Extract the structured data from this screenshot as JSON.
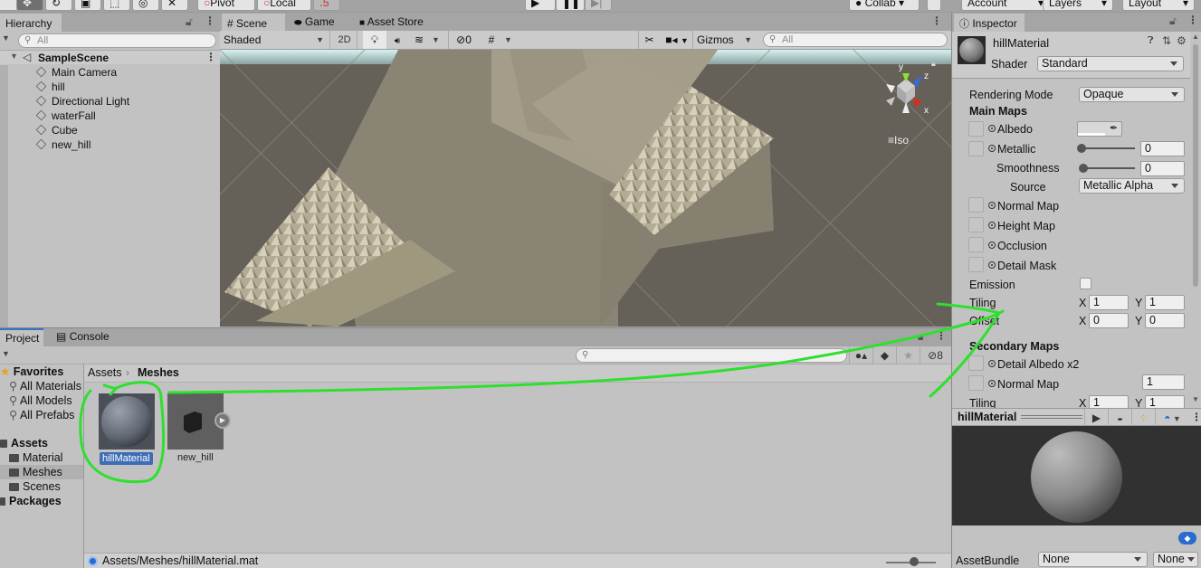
{
  "toolbar": {
    "pivot_label": "Pivot",
    "local_label": "Local",
    "collab_label": "Collab",
    "account_label": "Account",
    "layers_label": "Layers",
    "layout_label": "Layout"
  },
  "hierarchy": {
    "tab_label": "Hierarchy",
    "search_placeholder": "All",
    "scene_name": "SampleScene",
    "items": [
      {
        "label": "Main Camera"
      },
      {
        "label": "hill"
      },
      {
        "label": "Directional Light"
      },
      {
        "label": "waterFall"
      },
      {
        "label": "Cube"
      },
      {
        "label": "new_hill"
      }
    ]
  },
  "scene": {
    "tabs": [
      {
        "label": "Scene",
        "icon": "grid-icon"
      },
      {
        "label": "Game",
        "icon": "gamepad-icon"
      },
      {
        "label": "Asset Store",
        "icon": "bag-icon"
      }
    ],
    "shading_mode": "Shaded",
    "btn_2d": "2D",
    "hidden_count": "0",
    "gizmos_label": "Gizmos",
    "search_placeholder": "All",
    "projection_label": "Iso",
    "axis_labels": {
      "x": "x",
      "y": "y",
      "z": "z"
    },
    "colors": {
      "x_axis": "#d0311f",
      "y_axis": "#8fe02c",
      "z_axis": "#2f6de0"
    }
  },
  "project": {
    "tabs": [
      {
        "label": "Project"
      },
      {
        "label": "Console"
      }
    ],
    "hidden_count": "8",
    "favorites_label": "Favorites",
    "favorites": [
      {
        "label": "All Materials"
      },
      {
        "label": "All Models"
      },
      {
        "label": "All Prefabs"
      }
    ],
    "assets_label": "Assets",
    "asset_folders": [
      {
        "label": "Material",
        "selected": false
      },
      {
        "label": "Meshes",
        "selected": true
      },
      {
        "label": "Scenes",
        "selected": false
      }
    ],
    "packages_label": "Packages",
    "breadcrumb": [
      {
        "label": "Assets"
      },
      {
        "label": "Meshes"
      }
    ],
    "files": [
      {
        "label": "hillMaterial",
        "selected": true
      },
      {
        "label": "new_hill",
        "selected": false
      }
    ],
    "status_path": "Assets/Meshes/hillMaterial.mat",
    "icon_size_fraction": 0.6
  },
  "inspector": {
    "tab_label": "Inspector",
    "material_name": "hillMaterial",
    "shader_label": "Shader",
    "shader_value": "Standard",
    "rendering_mode_label": "Rendering Mode",
    "rendering_mode_value": "Opaque",
    "main_maps_label": "Main Maps",
    "albedo_label": "Albedo",
    "metallic_label": "Metallic",
    "metallic_value": "0",
    "smoothness_label": "Smoothness",
    "smoothness_value": "0",
    "source_label": "Source",
    "source_value": "Metallic Alpha",
    "normal_map_label": "Normal Map",
    "height_map_label": "Height Map",
    "occlusion_label": "Occlusion",
    "detail_mask_label": "Detail Mask",
    "emission_label": "Emission",
    "tiling_label": "Tiling",
    "tiling_x": "1",
    "tiling_y": "1",
    "offset_label": "Offset",
    "offset_x": "0",
    "offset_y": "0",
    "x_label": "X",
    "y_label": "Y",
    "secondary_maps_label": "Secondary Maps",
    "detail_albedo_label": "Detail Albedo x2",
    "secondary_normal_label": "Normal Map",
    "secondary_normal_value": "1",
    "secondary_tiling_label": "Tiling",
    "secondary_tiling_x": "1",
    "secondary_tiling_y": "1",
    "preview_title": "hillMaterial",
    "assetbundle_label": "AssetBundle",
    "assetbundle_value": "None",
    "assetbundle_variant": "None"
  },
  "annotation": {
    "color": "#2ee02e"
  }
}
